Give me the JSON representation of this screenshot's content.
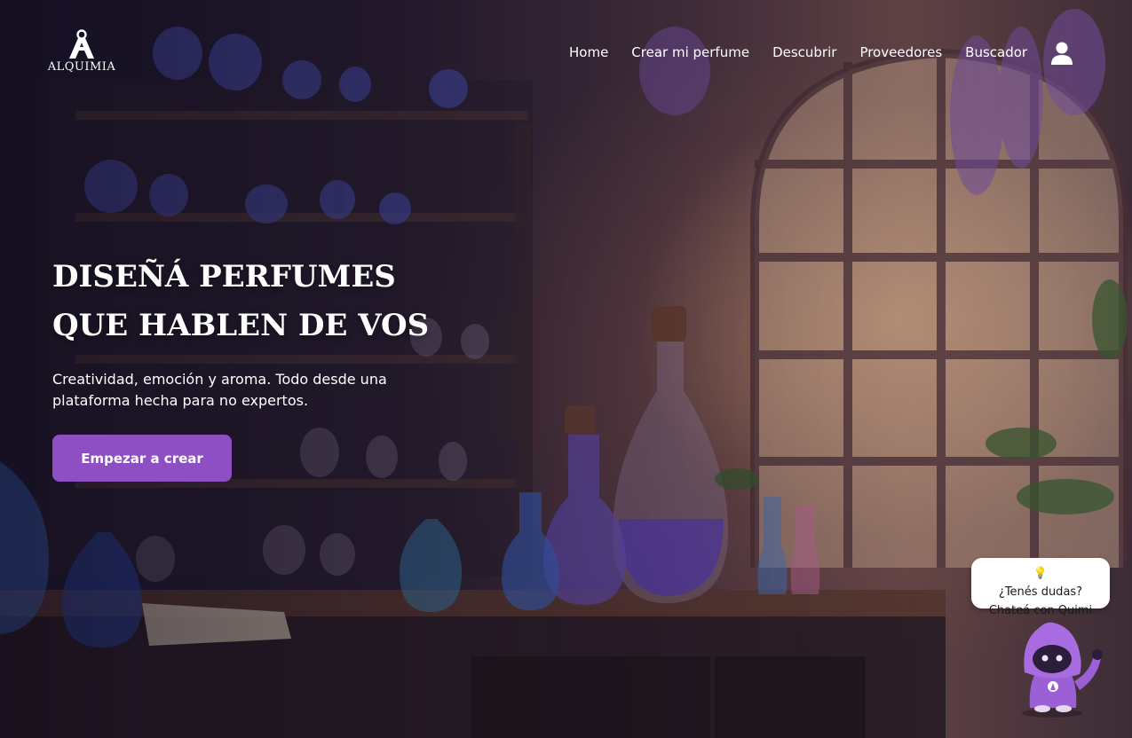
{
  "brand": {
    "name": "ALQUIMIA",
    "logo_icon": "alchemy-a-flask-logo"
  },
  "nav": {
    "items": [
      {
        "label": "Home"
      },
      {
        "label": "Crear mi perfume"
      },
      {
        "label": "Descubrir"
      },
      {
        "label": "Proveedores"
      },
      {
        "label": "Buscador"
      }
    ],
    "user_icon": "user-icon"
  },
  "hero": {
    "title_line1": "DISEÑÁ PERFUMES",
    "title_line2": "QUE HABLEN DE VOS",
    "subtitle": "Creatividad, emoción y aroma. Todo desde una plataforma hecha para no expertos.",
    "cta_label": "Empezar a crear",
    "background": "alchemy-lab-with-perfume-bottles-and-window"
  },
  "chat": {
    "icon": "lightbulb-icon",
    "line1": "¿Tenés dudas?",
    "line2": "Chateá con Quimi",
    "mascot": "quimi-wizard-mascot"
  },
  "colors": {
    "accent": "#8f4fc4",
    "text": "#ffffff",
    "bubble_bg": "#ffffff"
  }
}
